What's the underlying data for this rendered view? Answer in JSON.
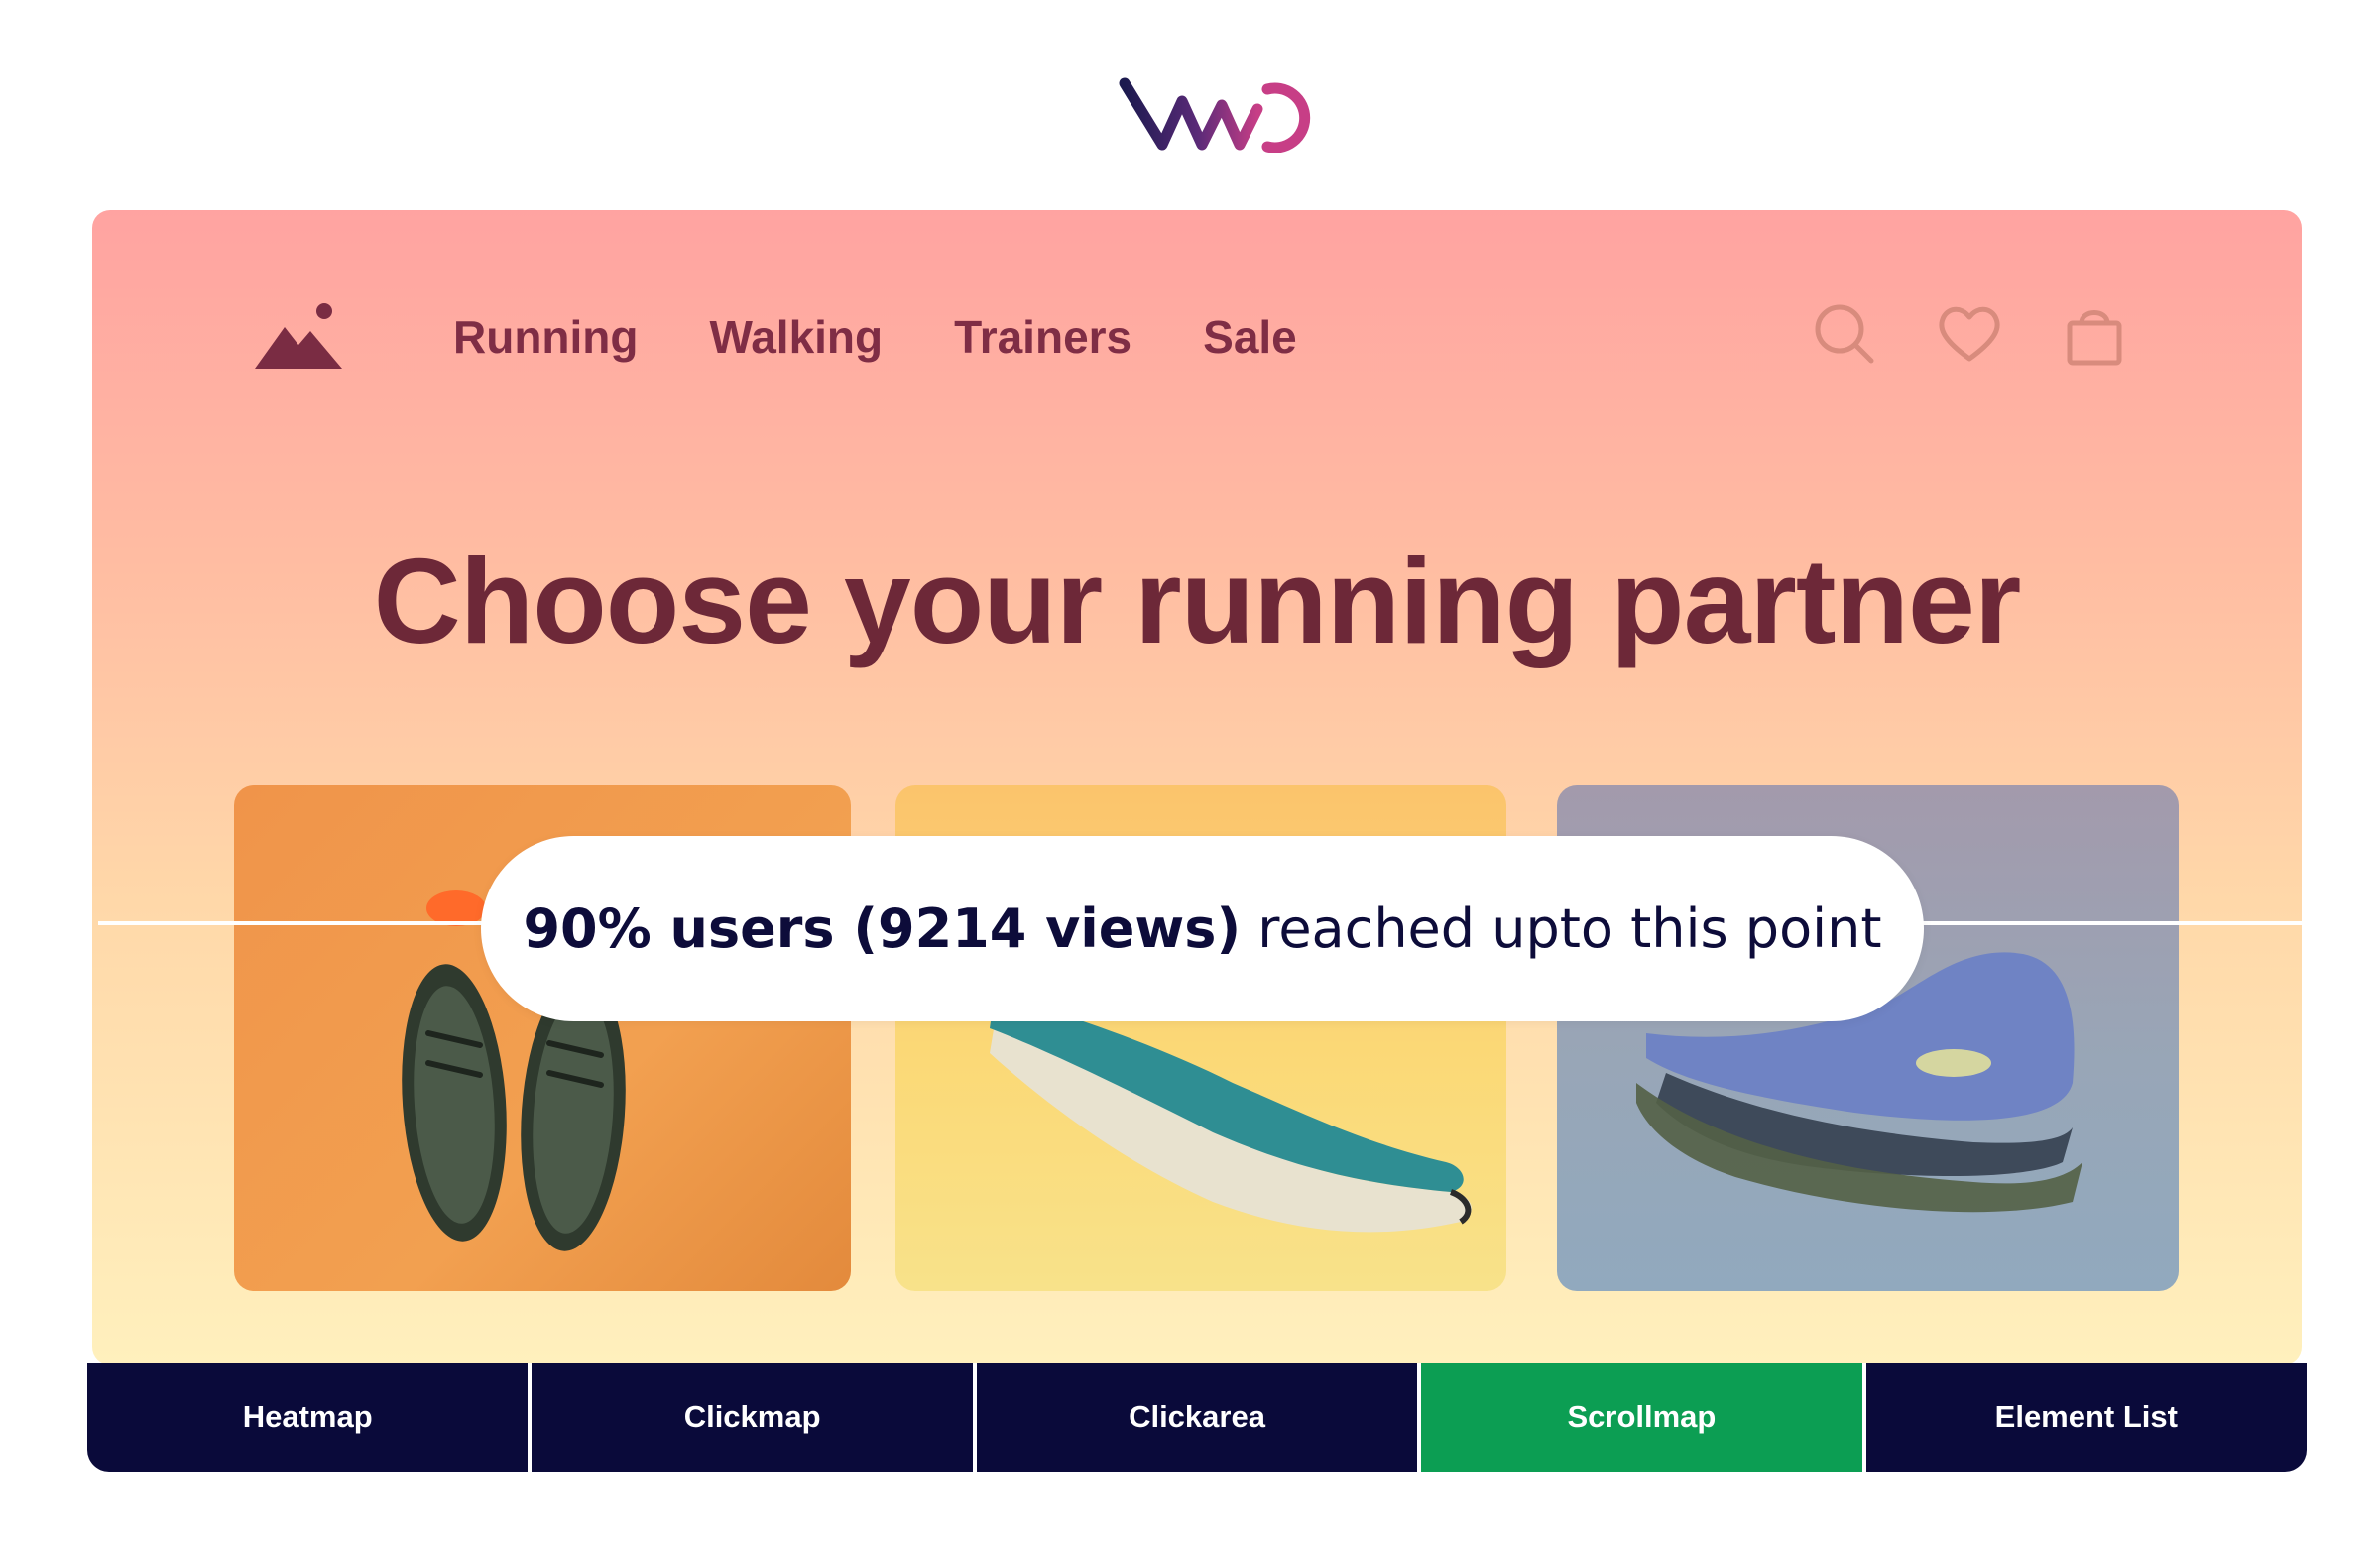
{
  "brand": {
    "logo_text": "VWO",
    "gradient_start": "#1c1a4f",
    "gradient_end": "#c73e86"
  },
  "site": {
    "logo_icon": "mountain-icon",
    "nav": [
      "Running",
      "Walking",
      "Trainers",
      "Sale"
    ],
    "icons": [
      "search-icon",
      "heart-icon",
      "shopping-bag-icon"
    ],
    "hero_title": "Choose your running partner",
    "products": [
      {
        "icon": "pair-of-sneakers-image"
      },
      {
        "icon": "teal-running-shoe-image"
      },
      {
        "icon": "blue-sneaker-image"
      }
    ]
  },
  "scrollmap": {
    "strong": "90% users (9214 views)",
    "rest": " reached upto this point"
  },
  "tabs": [
    {
      "label": "Heatmap",
      "active": false
    },
    {
      "label": "Clickmap",
      "active": false
    },
    {
      "label": "Clickarea",
      "active": false
    },
    {
      "label": "Scrollmap",
      "active": true
    },
    {
      "label": "Element List",
      "active": false
    }
  ],
  "colors": {
    "tab_default": "#0a0a3a",
    "tab_active": "#0c9e53",
    "nav_text": "#7f2d45",
    "hero_text": "#6d2838"
  }
}
